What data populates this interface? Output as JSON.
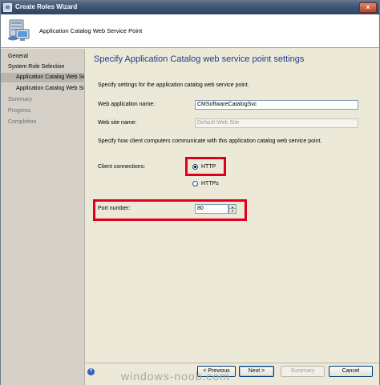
{
  "window": {
    "title": "Create Roles Wizard",
    "close_glyph": "×"
  },
  "header": {
    "title": "Application Catalog Web Service Point",
    "icon": "computer-network-icon"
  },
  "nav": {
    "items": [
      {
        "label": "General",
        "state": "normal"
      },
      {
        "label": "System Role Selection",
        "state": "normal"
      },
      {
        "label": "Application Catalog Web Se",
        "state": "selected"
      },
      {
        "label": "Application Catalog Web Sit",
        "state": "normal"
      },
      {
        "label": "Summary",
        "state": "disabled"
      },
      {
        "label": "Progress",
        "state": "disabled"
      },
      {
        "label": "Completion",
        "state": "disabled"
      }
    ]
  },
  "main": {
    "heading": "Specify Application Catalog web service point settings",
    "intro": "Specify settings for the application catalog web service point.",
    "web_app_label": "Web application name:",
    "web_app_value": "CMSoftwareCatalogSvc",
    "web_site_label": "Web site name:",
    "web_site_value": "Default Web Site",
    "communicate_text": "Specify how client computers communicate with this application catalog web service point.",
    "client_connections_label": "Client connections:",
    "http_label": "HTTP",
    "https_label": "HTTPs",
    "selected_connection": "HTTP",
    "port_label": "Port number:",
    "port_value": "80",
    "highlight_color": "#e0001a"
  },
  "footer": {
    "previous_label": "< Previous",
    "next_label": "Next >",
    "summary_label": "Summary",
    "cancel_label": "Cancel"
  },
  "watermark": "windows-noob.com"
}
